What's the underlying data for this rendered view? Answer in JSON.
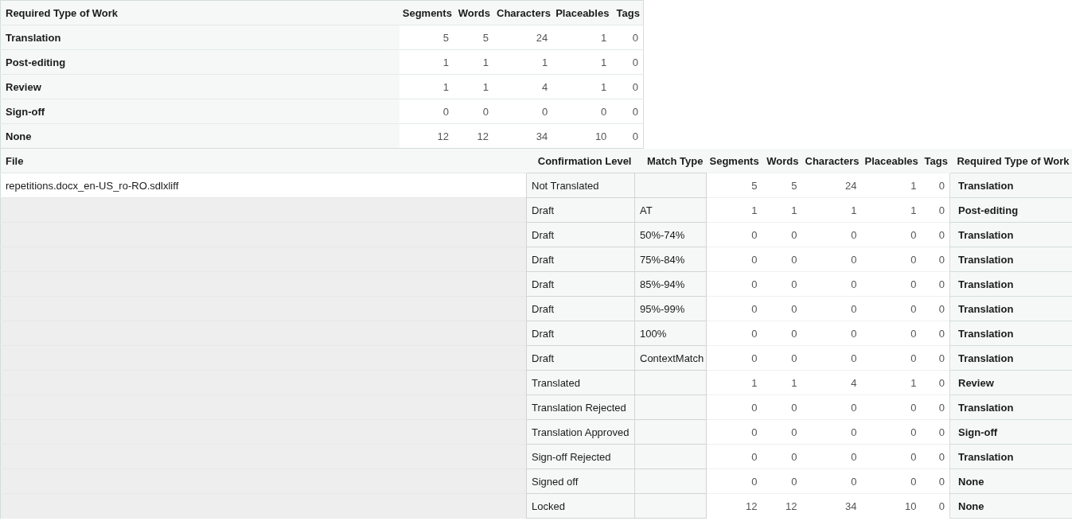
{
  "summary": {
    "columns": [
      "Required Type of Work",
      "Segments",
      "Words",
      "Characters",
      "Placeables",
      "Tags"
    ],
    "rows": [
      {
        "work_type": "Translation",
        "values": [
          "5",
          "5",
          "24",
          "1",
          "0"
        ]
      },
      {
        "work_type": "Post-editing",
        "values": [
          "1",
          "1",
          "1",
          "1",
          "0"
        ]
      },
      {
        "work_type": "Review",
        "values": [
          "1",
          "1",
          "4",
          "1",
          "0"
        ]
      },
      {
        "work_type": "Sign-off",
        "values": [
          "0",
          "0",
          "0",
          "0",
          "0"
        ]
      },
      {
        "work_type": "None",
        "values": [
          "12",
          "12",
          "34",
          "10",
          "0"
        ]
      }
    ]
  },
  "details": {
    "columns": [
      "File",
      "Confirmation Level",
      "Match Type",
      "Segments",
      "Words",
      "Characters",
      "Placeables",
      "Tags",
      "Required Type of Work"
    ],
    "rows": [
      {
        "file": "repetitions.docx_en-US_ro-RO.sdlxliff",
        "confirmation": "Not Translated",
        "values": [
          "5",
          "5",
          "24",
          "1",
          "0"
        ],
        "work_type": "Translation"
      },
      {
        "confirmation": "Draft",
        "match_type": "AT",
        "values": [
          "1",
          "1",
          "1",
          "1",
          "0"
        ],
        "work_type": "Post-editing"
      },
      {
        "confirmation": "Draft",
        "match_type": "50%-74%",
        "values": [
          "0",
          "0",
          "0",
          "0",
          "0"
        ],
        "work_type": "Translation"
      },
      {
        "confirmation": "Draft",
        "match_type": "75%-84%",
        "values": [
          "0",
          "0",
          "0",
          "0",
          "0"
        ],
        "work_type": "Translation"
      },
      {
        "confirmation": "Draft",
        "match_type": "85%-94%",
        "values": [
          "0",
          "0",
          "0",
          "0",
          "0"
        ],
        "work_type": "Translation"
      },
      {
        "confirmation": "Draft",
        "match_type": "95%-99%",
        "values": [
          "0",
          "0",
          "0",
          "0",
          "0"
        ],
        "work_type": "Translation"
      },
      {
        "confirmation": "Draft",
        "match_type": "100%",
        "values": [
          "0",
          "0",
          "0",
          "0",
          "0"
        ],
        "work_type": "Translation"
      },
      {
        "confirmation": "Draft",
        "match_type": "ContextMatch",
        "values": [
          "0",
          "0",
          "0",
          "0",
          "0"
        ],
        "work_type": "Translation"
      },
      {
        "confirmation": "Translated",
        "values": [
          "1",
          "1",
          "4",
          "1",
          "0"
        ],
        "work_type": "Review"
      },
      {
        "confirmation": "Translation Rejected",
        "values": [
          "0",
          "0",
          "0",
          "0",
          "0"
        ],
        "work_type": "Translation"
      },
      {
        "confirmation": "Translation Approved",
        "values": [
          "0",
          "0",
          "0",
          "0",
          "0"
        ],
        "work_type": "Sign-off"
      },
      {
        "confirmation": "Sign-off Rejected",
        "values": [
          "0",
          "0",
          "0",
          "0",
          "0"
        ],
        "work_type": "Translation"
      },
      {
        "confirmation": "Signed off",
        "values": [
          "0",
          "0",
          "0",
          "0",
          "0"
        ],
        "work_type": "None"
      },
      {
        "confirmation": "Locked",
        "values": [
          "12",
          "12",
          "34",
          "10",
          "0"
        ],
        "work_type": "None"
      }
    ]
  }
}
